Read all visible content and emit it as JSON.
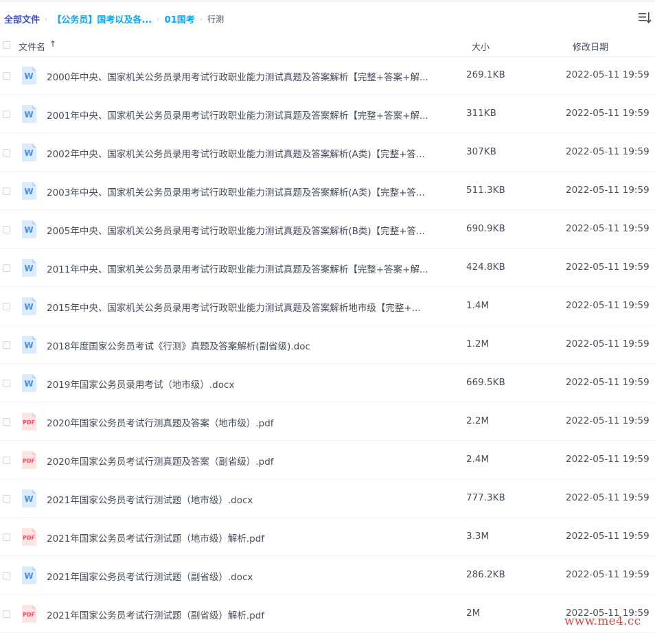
{
  "breadcrumb": {
    "items": [
      "全部文件",
      "【公务员】国考以及各...",
      "01国考",
      "行测"
    ],
    "separator": "›"
  },
  "header": {
    "name": "文件名",
    "sort_arrow": "↑",
    "size": "大小",
    "date": "修改日期"
  },
  "files": [
    {
      "type": "word",
      "name": "2000年中央、国家机关公务员录用考试行政职业能力测试真题及答案解析【完整+答案+解...",
      "size": "269.1KB",
      "date": "2022-05-11 19:59"
    },
    {
      "type": "word",
      "name": "2001年中央、国家机关公务员录用考试行政职业能力测试真题及答案解析【完整+答案+解...",
      "size": "311KB",
      "date": "2022-05-11 19:59"
    },
    {
      "type": "word",
      "name": "2002年中央、国家机关公务员录用考试行政职业能力测试真题及答案解析(A类)【完整+答...",
      "size": "307KB",
      "date": "2022-05-11 19:59"
    },
    {
      "type": "word",
      "name": "2003年中央、国家机关公务员录用考试行政职业能力测试真题及答案解析(A类)【完整+答...",
      "size": "511.3KB",
      "date": "2022-05-11 19:59"
    },
    {
      "type": "word",
      "name": "2005年中央、国家机关公务员录用考试行政职业能力测试真题及答案解析(B类)【完整+答...",
      "size": "690.9KB",
      "date": "2022-05-11 19:59"
    },
    {
      "type": "word",
      "name": "2011年中央、国家机关公务员录用考试行政职业能力测试真题及答案解析【完整+答案+解...",
      "size": "424.8KB",
      "date": "2022-05-11 19:59"
    },
    {
      "type": "word",
      "name": "2015年中央、国家机关公务员录用考试行政职业能力测试真题及答案解析地市级【完整+...",
      "size": "1.4M",
      "date": "2022-05-11 19:59"
    },
    {
      "type": "word",
      "name": "2018年度国家公务员考试《行测》真题及答案解析(副省级).doc",
      "size": "1.2M",
      "date": "2022-05-11 19:59"
    },
    {
      "type": "word",
      "name": "2019年国家公务员录用考试（地市级）.docx",
      "size": "669.5KB",
      "date": "2022-05-11 19:59"
    },
    {
      "type": "pdf",
      "name": "2020年国家公务员考试行测真题及答案（地市级）.pdf",
      "size": "2.2M",
      "date": "2022-05-11 19:59"
    },
    {
      "type": "pdf",
      "name": "2020年国家公务员考试行测真题及答案（副省级）.pdf",
      "size": "2.4M",
      "date": "2022-05-11 19:59"
    },
    {
      "type": "word",
      "name": "2021年国家公务员考试行测试题（地市级）.docx",
      "size": "777.3KB",
      "date": "2022-05-11 19:59"
    },
    {
      "type": "pdf",
      "name": "2021年国家公务员考试行测试题（地市级）解析.pdf",
      "size": "3.3M",
      "date": "2022-05-11 19:59"
    },
    {
      "type": "word",
      "name": "2021年国家公务员考试行测试题（副省级）.docx",
      "size": "286.2KB",
      "date": "2022-05-11 19:59"
    },
    {
      "type": "pdf",
      "name": "2021年国家公务员考试行测试题（副省级）解析.pdf",
      "size": "2M",
      "date": "2022-05-11 19:59"
    }
  ],
  "icons": {
    "word_label": "W",
    "pdf_label": "PDF",
    "sort_icon": "list-sort-icon"
  },
  "watermark": "www.me4.cc",
  "colors": {
    "accent": "#06a7ff",
    "root_crumb": "#3a50d9",
    "word_icon": "#4a90ea",
    "pdf_icon": "#f3515b",
    "text": "#454d5a"
  }
}
